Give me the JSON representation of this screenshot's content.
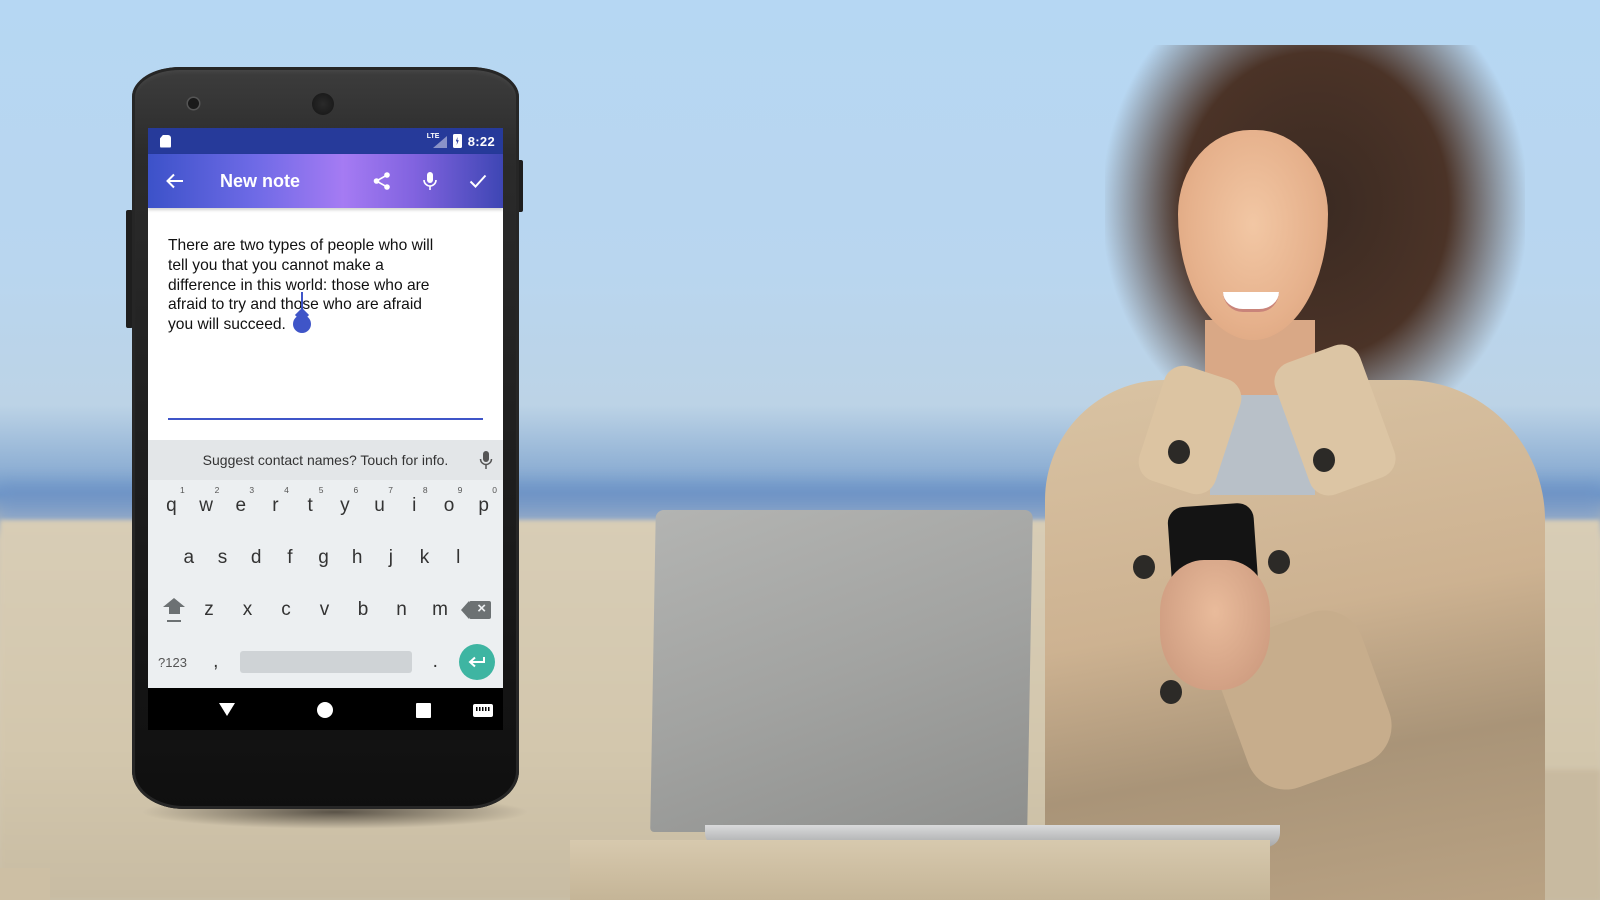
{
  "status_bar": {
    "network": "LTE",
    "time": "8:22",
    "icons": [
      "sd-card-icon",
      "lte-signal-icon",
      "battery-charging-icon"
    ]
  },
  "app_bar": {
    "title": "New note",
    "back_icon": "arrow-left-icon",
    "actions": [
      {
        "name": "share",
        "icon": "share-icon"
      },
      {
        "name": "voice-input",
        "icon": "microphone-icon"
      },
      {
        "name": "save",
        "icon": "checkmark-icon"
      }
    ]
  },
  "note": {
    "text": "There are two types of people who will\ntell you that you cannot make a\ndifference in this world: those who are\nafraid to try and those who are afraid\nyou will succeed."
  },
  "keyboard": {
    "suggestion": "Suggest contact names? Touch for info.",
    "row1": [
      {
        "key": "q",
        "hint": "1"
      },
      {
        "key": "w",
        "hint": "2"
      },
      {
        "key": "e",
        "hint": "3"
      },
      {
        "key": "r",
        "hint": "4"
      },
      {
        "key": "t",
        "hint": "5"
      },
      {
        "key": "y",
        "hint": "6"
      },
      {
        "key": "u",
        "hint": "7"
      },
      {
        "key": "i",
        "hint": "8"
      },
      {
        "key": "o",
        "hint": "9"
      },
      {
        "key": "p",
        "hint": "0"
      }
    ],
    "row2": [
      "a",
      "s",
      "d",
      "f",
      "g",
      "h",
      "j",
      "k",
      "l"
    ],
    "row3": [
      "z",
      "x",
      "c",
      "v",
      "b",
      "n",
      "m"
    ],
    "symbols_label": "?123",
    "comma": ",",
    "period": ".",
    "enter_color": "#3eb5a2"
  },
  "nav_bar": {
    "buttons": [
      "back",
      "home",
      "recents",
      "keyboard-switch"
    ]
  },
  "colors": {
    "status_bar": "#263a9a",
    "accent": "#3f55c8",
    "app_bar_gradient": [
      "#3c52c9",
      "#a57bf3",
      "#3e46b4"
    ]
  }
}
